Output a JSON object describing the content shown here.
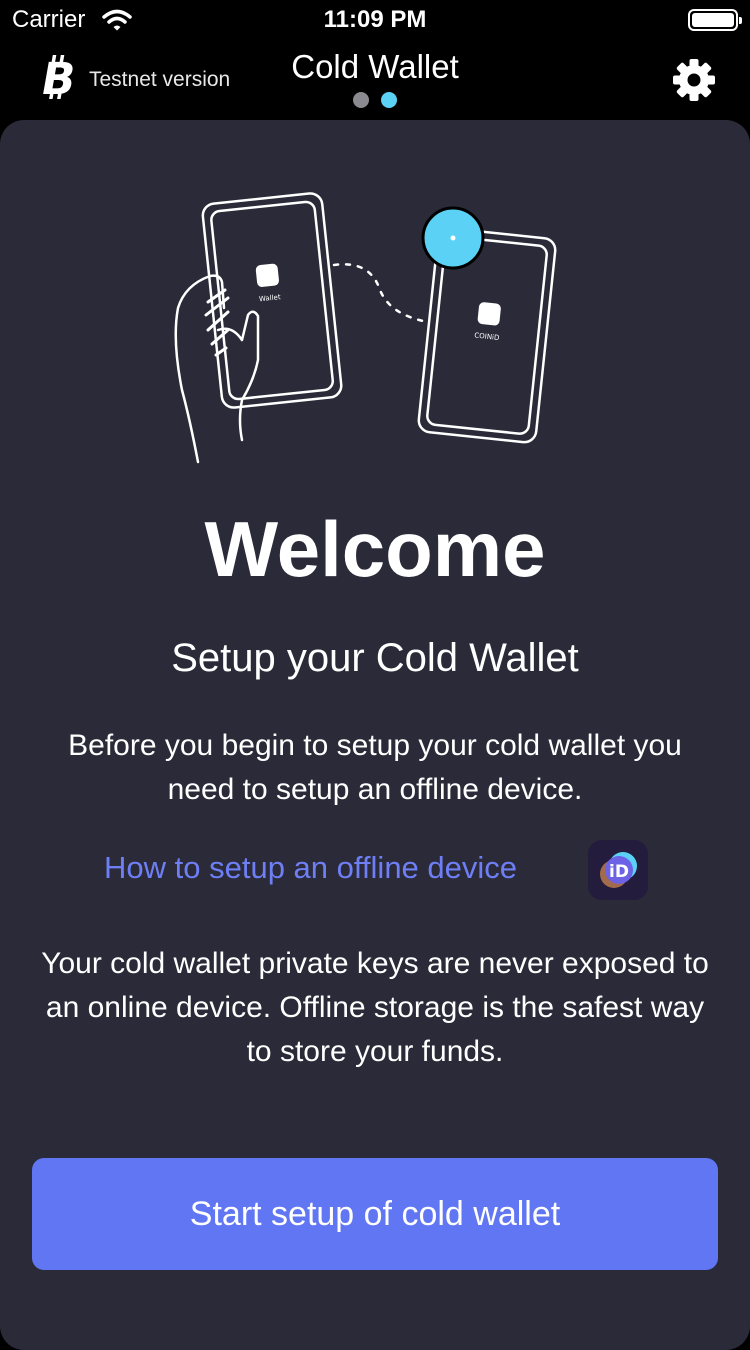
{
  "status_bar": {
    "carrier": "Carrier",
    "time": "11:09 PM"
  },
  "nav": {
    "network_label": "Testnet version",
    "title": "Cold Wallet",
    "page_indicator": {
      "count": 2,
      "active_index": 1
    }
  },
  "illustration": {
    "left_phone_label": "Wallet",
    "right_phone_label": "COINiD"
  },
  "main": {
    "heading": "Welcome",
    "subheading": "Setup your Cold Wallet",
    "intro": "Before you begin to setup your cold wallet you need to setup an offline device.",
    "help_link": "How to setup an offline device",
    "security_note": "Your cold wallet private keys are never exposed to an online device. Offline storage is the safest way to store your funds.",
    "cta_label": "Start setup of cold wallet"
  },
  "colors": {
    "background": "#000000",
    "card": "#2a2a38",
    "accent": "#6076f2",
    "link": "#6e7ff5",
    "dot_active": "#5bd2f5",
    "dot_inactive": "#8a8a90"
  },
  "icons": [
    "wifi-icon",
    "battery-icon",
    "bitcoin-icon",
    "gear-icon",
    "coinid-icon"
  ]
}
